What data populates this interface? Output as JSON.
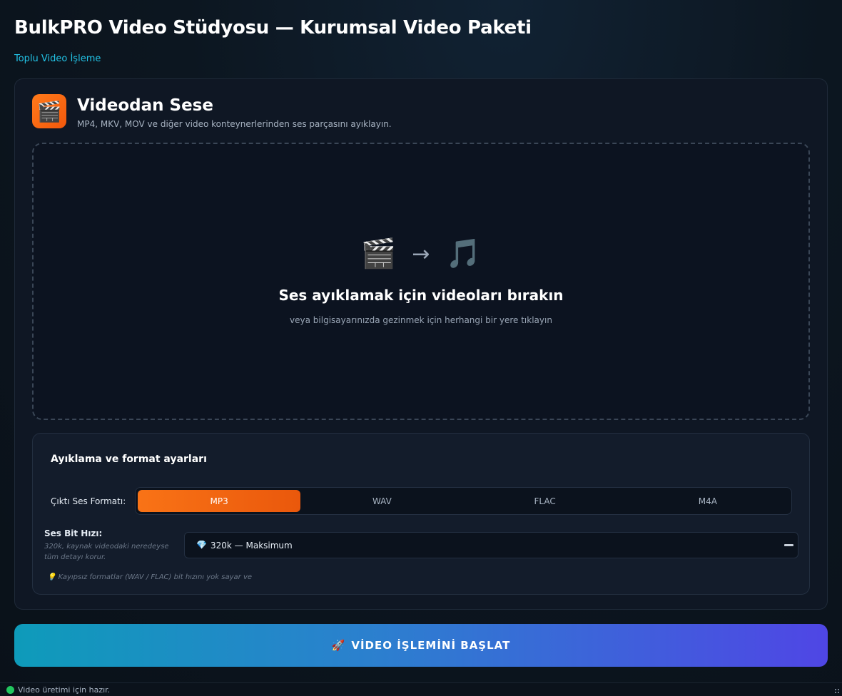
{
  "app": {
    "title": "BulkPRO Video Stüdyosu — Kurumsal Video Paketi",
    "subtitle": "Toplu Video İşleme"
  },
  "tool": {
    "icon": "clapperboard-icon",
    "title": "Videodan Sese",
    "description": "MP4, MKV, MOV ve diğer video konteynerlerinden ses parçasını ayıklayın."
  },
  "dropzone": {
    "from_icon": "🎬",
    "arrow": "→",
    "to_icon": "🎵",
    "title": "Ses ayıklamak için videoları bırakın",
    "hint": "veya bilgisayarınızda gezinmek için herhangi bir yere tıklayın"
  },
  "settings": {
    "title": "Ayıklama ve format ayarları",
    "format_label": "Çıktı Ses Formatı:",
    "formats": [
      "MP3",
      "WAV",
      "FLAC",
      "M4A"
    ],
    "selected_format": "MP3",
    "bitrate_label": "Ses Bit Hızı:",
    "bitrate_help": "320k, kaynak videodaki neredeyse tüm detayı korur.",
    "bitrate_icon": "💎",
    "bitrate_value": "320k — Maksimum",
    "note_icon": "💡",
    "note": "Kayıpsız formatlar (WAV / FLAC) bit hızını yok sayar ve"
  },
  "start_button": {
    "icon": "🚀",
    "label": "VİDEO İŞLEMİNİ BAŞLAT"
  },
  "status": {
    "color": "#22c55e",
    "text": "Video üretimi için hazır."
  }
}
